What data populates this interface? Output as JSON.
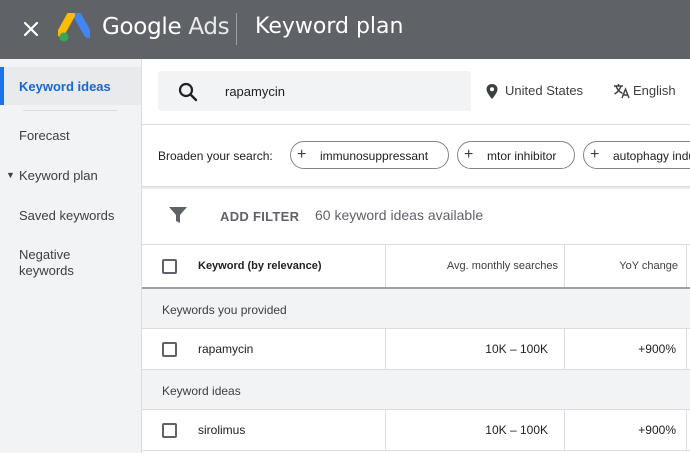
{
  "header": {
    "brand_google": "Google",
    "brand_ads": "Ads",
    "title": "Keyword plan"
  },
  "sidebar": {
    "items": [
      {
        "label": "Keyword ideas",
        "active": true
      },
      {
        "label": "Forecast"
      },
      {
        "label": "Keyword plan",
        "expander": "▼"
      },
      {
        "label": "Saved keywords"
      },
      {
        "label": "Negative keywords"
      }
    ]
  },
  "search": {
    "value": "rapamycin",
    "location": "United States",
    "language": "English"
  },
  "broaden": {
    "label": "Broaden your search:",
    "chips": [
      "immunosuppressant",
      "mtor inhibitor",
      "autophagy inducer"
    ]
  },
  "filter": {
    "add_filter": "ADD FILTER",
    "count_text": "60 keyword ideas available"
  },
  "table": {
    "columns": {
      "keyword": "Keyword (by relevance)",
      "avg": "Avg. monthly searches",
      "yoy": "YoY change"
    },
    "groups": [
      {
        "label": "Keywords you provided",
        "rows": [
          {
            "keyword": "rapamycin",
            "avg": "10K – 100K",
            "yoy": "+900%"
          }
        ]
      },
      {
        "label": "Keyword ideas",
        "rows": [
          {
            "keyword": "sirolimus",
            "avg": "10K – 100K",
            "yoy": "+900%"
          }
        ]
      }
    ]
  },
  "colors": {
    "topbar": "#5f6368",
    "accent": "#1a73e8",
    "sidebar_bg": "#f1f3f4"
  }
}
